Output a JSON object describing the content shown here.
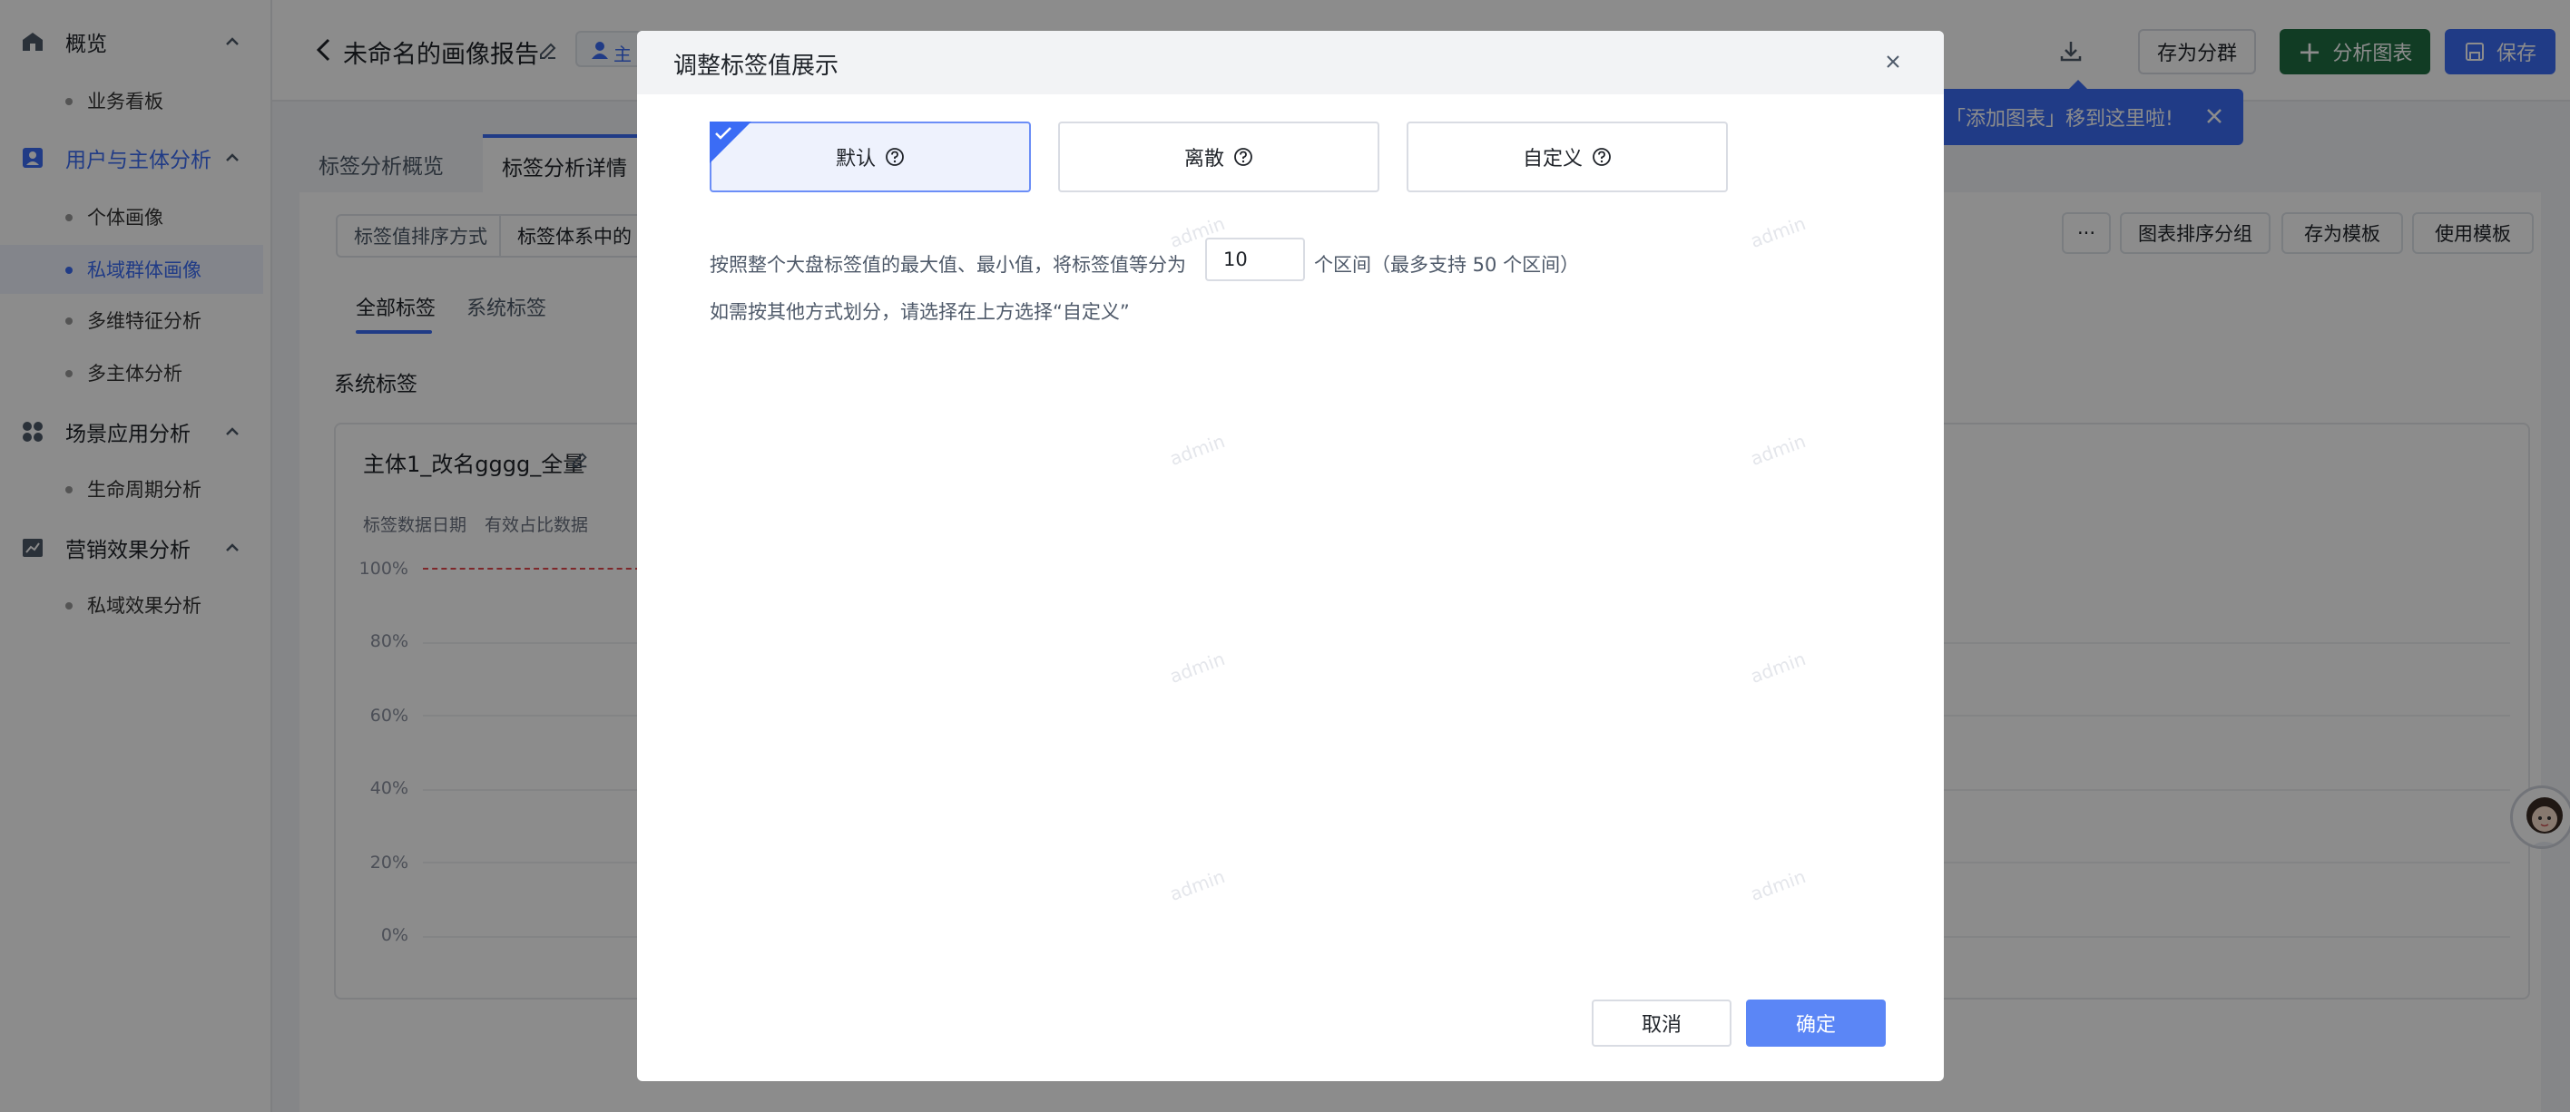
{
  "sidebar": {
    "groups": [
      {
        "label": "概览",
        "items": [
          {
            "label": "业务看板"
          }
        ]
      },
      {
        "label": "用户与主体分析",
        "items": [
          {
            "label": "个体画像"
          },
          {
            "label": "私域群体画像"
          },
          {
            "label": "多维特征分析"
          },
          {
            "label": "多主体分析"
          }
        ]
      },
      {
        "label": "场景应用分析",
        "items": [
          {
            "label": "生命周期分析"
          }
        ]
      },
      {
        "label": "营销效果分析",
        "items": [
          {
            "label": "私域效果分析"
          }
        ]
      }
    ],
    "active_item": "私域群体画像"
  },
  "header": {
    "title": "未命名的画像报告",
    "subject_chip": "主",
    "save_group_label": "存为分群",
    "add_chart_label": "分析图表",
    "save_label": "保存",
    "tooltip": "「添加图表」移到这里啦!"
  },
  "main": {
    "tabs": [
      {
        "label": "标签分析概览"
      },
      {
        "label": "标签分析详情"
      }
    ],
    "sort_select": {
      "label": "标签值排序方式",
      "value": "标签体系中的"
    },
    "sub_tabs": [
      {
        "label": "全部标签"
      },
      {
        "label": "系统标签"
      }
    ],
    "section_title": "系统标签",
    "tools": [
      {
        "label": "···"
      },
      {
        "label": "图表排序分组"
      },
      {
        "label": "存为模板"
      },
      {
        "label": "使用模板"
      }
    ],
    "chart_card": {
      "title": "主体1_改名gggg_全量",
      "meta": [
        "标签数据日期",
        "有效占比数据"
      ],
      "y_ticks": [
        "100%",
        "80%",
        "60%",
        "40%",
        "20%",
        "0%"
      ]
    }
  },
  "modal": {
    "title": "调整标签值展示",
    "options": [
      {
        "label": "默认",
        "selected": true
      },
      {
        "label": "离散",
        "selected": false
      },
      {
        "label": "自定义",
        "selected": false
      }
    ],
    "desc_before_input": "按照整个大盘标签值的最大值、最小值，将标签值等分为",
    "interval_count": "10",
    "desc_after_input": "个区间（最多支持 50 个区间）",
    "desc_line2": "如需按其他方式划分，请选择在上方选择“自定义”",
    "cancel_label": "取消",
    "ok_label": "确定",
    "watermark": "admin"
  },
  "colors": {
    "accent": "#3b6cf5",
    "add_chart_bg": "#1f6e43",
    "ok_button": "#5b86f6"
  }
}
